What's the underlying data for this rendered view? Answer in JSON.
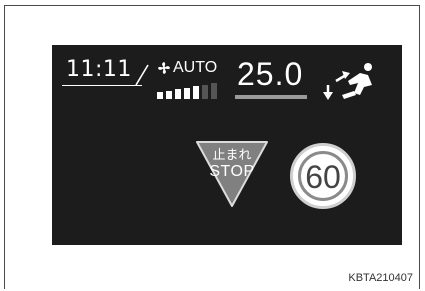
{
  "display": {
    "clock": "11:11",
    "climate": {
      "fan_icon": "fan-icon",
      "mode_label": "AUTO",
      "fan_level": 5,
      "fan_level_max": 7,
      "temperature": "25.0",
      "airflow_icon": "airflow-body-feet-icon"
    },
    "signs": {
      "stop_japanese": "止まれ",
      "stop_english": "STOP",
      "speed_limit": "60"
    }
  },
  "image_code": "KBTA210407",
  "colors": {
    "display_background": "#1c1c1c",
    "stop_sign": "#808080",
    "speed_sign_face": "#ffffff",
    "speed_sign_ring": "#8a8a8a"
  }
}
